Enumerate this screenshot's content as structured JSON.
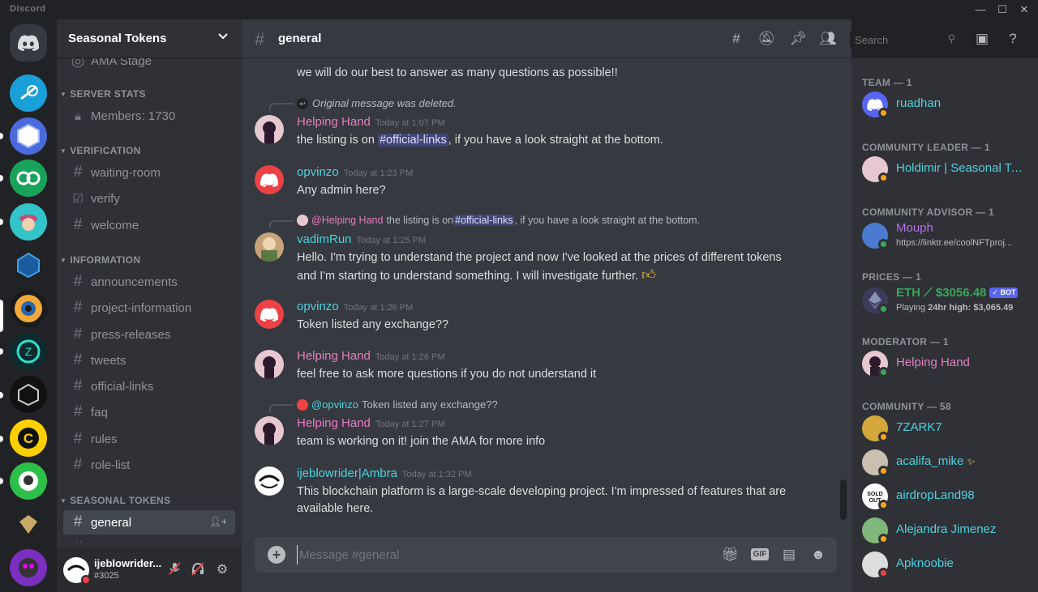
{
  "app": {
    "name": "Discord"
  },
  "server": {
    "name": "Seasonal Tokens"
  },
  "channels": {
    "partial_top": "AMA Stage",
    "cat_server_stats": "SERVER STATS",
    "members_count": "Members: 1730",
    "cat_verification": "VERIFICATION",
    "waiting_room": "waiting-room",
    "verify": "verify",
    "welcome": "welcome",
    "cat_information": "INFORMATION",
    "announcements": "announcements",
    "project_information": "project-information",
    "press_releases": "press-releases",
    "tweets": "tweets",
    "official_links": "official-links",
    "faq": "faq",
    "rules": "rules",
    "role_list": "role-list",
    "cat_seasonal": "SEASONAL TOKENS",
    "general": "general",
    "partial_bottom": "media"
  },
  "user": {
    "name": "ijeblowrider...",
    "tag": "#3025"
  },
  "chat": {
    "channel": "general",
    "search_placeholder": "Search",
    "composer_placeholder": "Message #general"
  },
  "messages": {
    "m0_text": "we will do our best to answer as many questions as possible!!",
    "m1_reply": "Original message was deleted.",
    "m1_author": "Helping Hand",
    "m1_time": "Today at 1:07 PM",
    "m1_text_a": "the listing is on ",
    "m1_mention": "#official-links",
    "m1_text_b": ", if you have a look straight at the bottom.",
    "m2_author": "opvinzo",
    "m2_time": "Today at 1:23 PM",
    "m2_text": "Any admin here?",
    "m3_reply_user": "@Helping Hand",
    "m3_reply_a": "the listing is on ",
    "m3_reply_mention": "#official-links",
    "m3_reply_b": ", if you have a look straight at the bottom.",
    "m3_author": "vadimRun",
    "m3_time": "Today at 1:25 PM",
    "m3_text1": "Hello. I'm trying to understand the project and now I've looked at the prices of different tokens",
    "m3_text2": "and I'm starting to understand something. I will investigate further.",
    "m4_author": "opvinzo",
    "m4_time": "Today at 1:26 PM",
    "m4_text": "Token listed any exchange??",
    "m5_author": "Helping Hand",
    "m5_time": "Today at 1:26 PM",
    "m5_text": "feel free to ask more questions if you do not understand it",
    "m6_reply_user": "@opvinzo",
    "m6_reply_text": "Token listed any exchange??",
    "m6_author": "Helping Hand",
    "m6_time": "Today at 1:27 PM",
    "m6_text": "team is working on it! join the AMA for more info",
    "m7_author": "ijeblowrider|Ambra",
    "m7_time": "Today at 1:32 PM",
    "m7_text1": "This blockchain platform is a large-scale developing project. I'm impressed of features that are",
    "m7_text2": "available here."
  },
  "members": {
    "team": "TEAM — 1",
    "ruadhan": "ruadhan",
    "community_leader": "COMMUNITY LEADER — 1",
    "holdimir": "Holdimir | Seasonal To...",
    "community_advisor": "COMMUNITY ADVISOR — 1",
    "mouph": "Mouph",
    "mouph_status": "https://linktr.ee/coolNFTproj...",
    "prices": "PRICES — 1",
    "eth_name": "ETH ⟋ $3056.48",
    "bot": "✓ BOT",
    "eth_playing_a": "Playing ",
    "eth_playing_b": "24hr high: $3,065.49",
    "moderator": "MODERATOR — 1",
    "helping_hand": "Helping Hand",
    "community": "COMMUNITY — 58",
    "m_7zark7": "7ZARK7",
    "acalifa": "acalifa_mike",
    "airdrop": "airdropLand98",
    "alejandra": "Alejandra Jimenez",
    "apknoobie": "Apknoobie"
  },
  "colors": {
    "pink": "#e67ec1",
    "teal": "#4fd1e0",
    "green": "#3ba55d",
    "purple": "#b56ee8",
    "cyan": "#00b0f4"
  }
}
